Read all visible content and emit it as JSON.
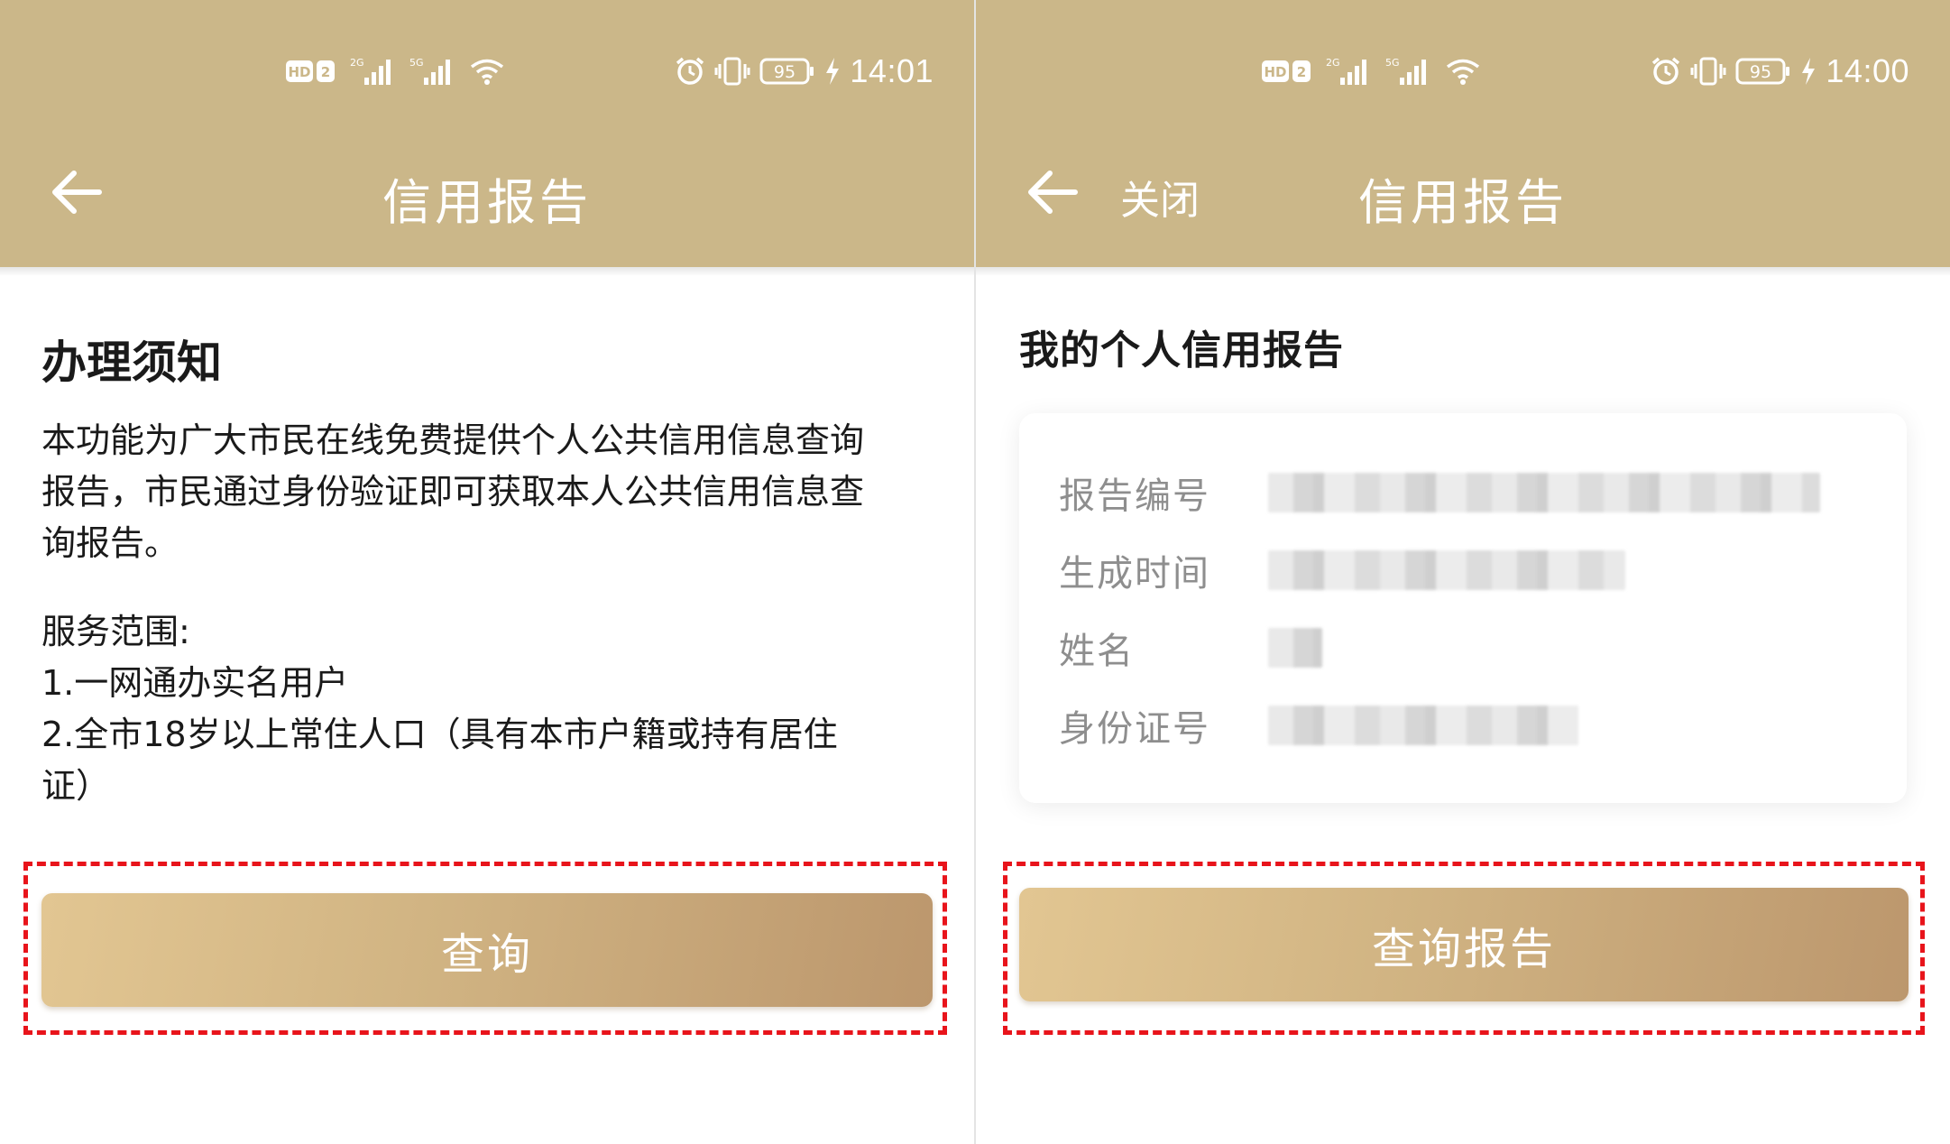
{
  "status_bar": {
    "signal_badges": [
      "HD",
      "2"
    ],
    "network_left": "2G",
    "network_right": "5G",
    "battery": "95",
    "time_left_screen": "14:01",
    "time_right_screen": "14:00"
  },
  "left_screen": {
    "title": "信用报告",
    "notice_title": "办理须知",
    "notice_body": "本功能为广大市民在线免费提供个人公共信用信息查询\n报告，市民通过身份验证即可获取本人公共信用信息查\n询报告。",
    "scope_title": "服务范围:",
    "scope_items": [
      "1.一网通办实名用户",
      "2.全市18岁以上常住人口（具有本市户籍或持有居住\n证）"
    ],
    "query_button": "查询"
  },
  "right_screen": {
    "close_label": "关闭",
    "title": "信用报告",
    "report_heading": "我的个人信用报告",
    "fields": [
      {
        "label": "报告编号"
      },
      {
        "label": "生成时间"
      },
      {
        "label": "姓名"
      },
      {
        "label": "身份证号"
      }
    ],
    "query_report_button": "查询报告"
  },
  "icons": {
    "back": "arrow-left-icon",
    "alarm": "alarm-icon",
    "vibrate": "vibrate-icon",
    "battery": "battery-icon",
    "charging": "charging-icon",
    "wifi": "wifi-icon",
    "signal": "signal-bars-icon"
  },
  "colors": {
    "header": "#cbb789",
    "button_start": "#e2c692",
    "button_end": "#bc976d",
    "highlight_dash": "#e8141b"
  }
}
